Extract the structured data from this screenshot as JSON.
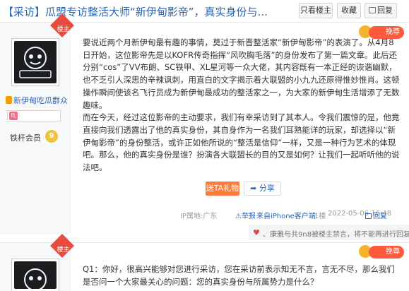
{
  "header": {
    "title": "【采访】瓜盟专访整活大师“新伊甸影帝”，真实身份与...",
    "buttons": {
      "only_op": "只看楼主",
      "favorite": "收藏",
      "reply": "回复"
    }
  },
  "post1": {
    "lz_badge": "楼主",
    "user": {
      "name": "新伊甸吃瓜群众",
      "gender_symbol": "♏",
      "level_label": "铁杆会员",
      "level_num": "9"
    },
    "vip_label": "挽尊",
    "paragraphs": [
      "要说近两个月新伊甸最有趣的事情，莫过于新晋整活家“新伊甸影帝”的表演了。从4月8日开始，这位影帝先是以KOFR传奇指挥“风吹胸毛落”的身份发布了第一篇文章。此后还分别“cos”了VV布朗、SC铁甲、XL星河等一众大佬，其内容既有一本正经的诙谐幽默，也不乏引人深思的辛辣讽刺，用直白的文字揭示着大联盟的小九九还原得惟妙惟肖。这顿操作瞬间使该名飞行员成为新伊甸最成功的整活家之一，为大家的新伊甸生活增添了无数趣味。",
      "而在今天，经过这位影帝的主动要求，我们有幸采访到了其本人。令我们震惊的是，他竟直接向我们透露出了他的真实身份，其自身作为一名我们耳熟能详的玩家，却选择以“新伊甸影帝”的身份整活，或许正如他所说的“整活是信仰”一样，又是一种行为艺术的体现吧。那么，他的真实身份是谁？扮演各大联盟长的目的又是如何？让我们一起听听他的说法吧。"
    ],
    "gift_label": "送TA礼物",
    "share_label": "分享",
    "meta": {
      "ip": "IP属地:广东",
      "report": "举报",
      "client": "来自iPhone客户端",
      "floor": "1楼",
      "time": "2022-05-06 16:48",
      "reply": "回复"
    },
    "likes_text": "、康雅与共9n8被楼主禁言，将不能再进行回复"
  },
  "post2": {
    "lz_badge": "楼主",
    "vip_label": "挽尊",
    "paragraphs": [
      "Q1：你好，很高兴能够对您进行采访，您在采访前表示知无不言，言无不尽，那么我们是否问一个大家最关心的问题：您的真实身份与所属势力是什么？"
    ]
  },
  "colors": {
    "link": "#2d64b3",
    "accent": "#ff7d3a",
    "badge_red": "#e74c3c"
  },
  "icons": [
    "gift-icon",
    "share-icon",
    "report-icon",
    "reply-icon",
    "heart-icon",
    "vip-crown-icon"
  ]
}
